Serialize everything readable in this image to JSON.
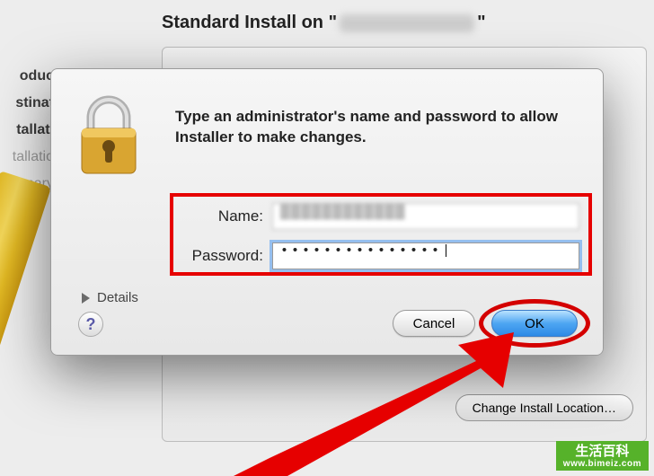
{
  "header": {
    "title_prefix": "Standard Install on \"",
    "title_suffix": "\""
  },
  "sidebar": {
    "items": [
      {
        "label": "oduc"
      },
      {
        "label": "stinat"
      },
      {
        "label": "tallati"
      },
      {
        "label": "tallatio"
      },
      {
        "label": "mmary"
      }
    ]
  },
  "dialog": {
    "prompt": "Type an administrator's name and password to allow Installer to make changes.",
    "name_label": "Name:",
    "password_label": "Password:",
    "name_value": "████████████",
    "password_value": "•••••••••••••••|",
    "details_label": "Details",
    "help_label": "?",
    "cancel_label": "Cancel",
    "ok_label": "OK"
  },
  "footer": {
    "change_location_label": "Change Install Location…"
  },
  "watermark": {
    "line1": "生活百科",
    "line2": "www.bimeiz.com"
  }
}
